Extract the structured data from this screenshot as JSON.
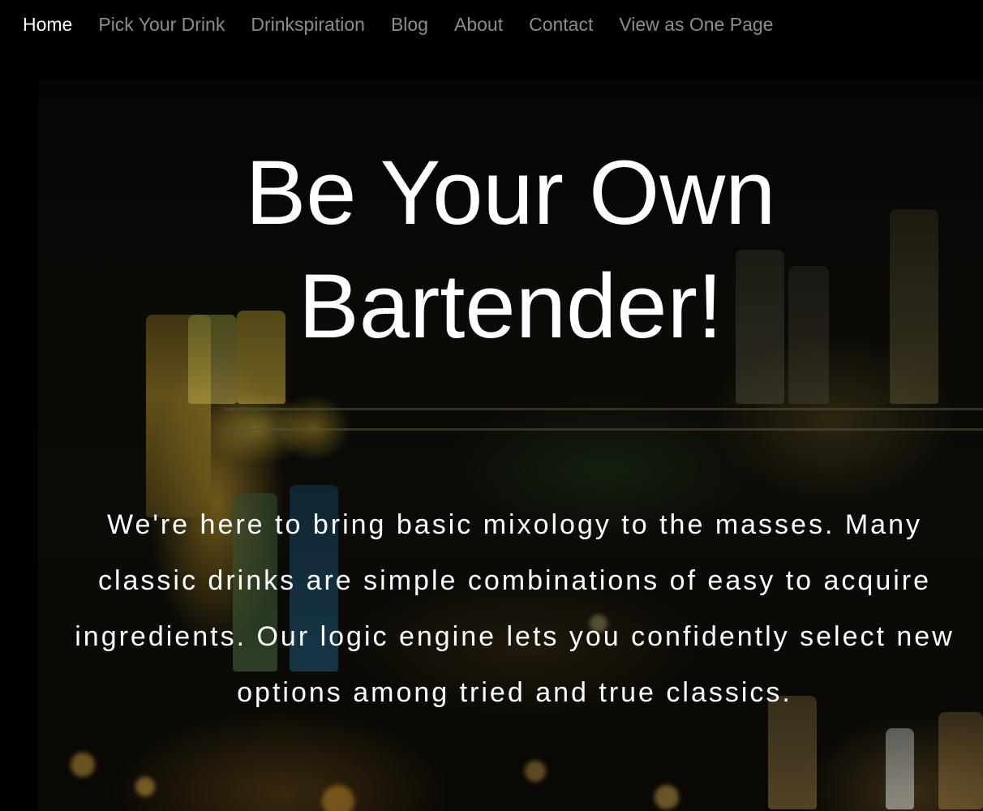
{
  "nav": {
    "items": [
      {
        "label": "Home",
        "active": true
      },
      {
        "label": "Pick Your Drink",
        "active": false
      },
      {
        "label": "Drinkspiration",
        "active": false
      },
      {
        "label": "Blog",
        "active": false
      },
      {
        "label": "About",
        "active": false
      },
      {
        "label": "Contact",
        "active": false
      },
      {
        "label": "View as One Page",
        "active": false
      }
    ]
  },
  "hero": {
    "title": "Be Your Own Bartender!",
    "text": "We're here to bring basic mixology to the masses. Many classic drinks are simple combinations of easy to acquire ingredients. Our logic engine lets you confidently select new options among tried and true classics.",
    "background_image": "bar-shelves-with-bottles"
  },
  "colors": {
    "nav_bg": "#000000",
    "nav_active": "#ffffff",
    "nav_inactive": "#8c8c8c",
    "hero_text": "#ffffff"
  }
}
